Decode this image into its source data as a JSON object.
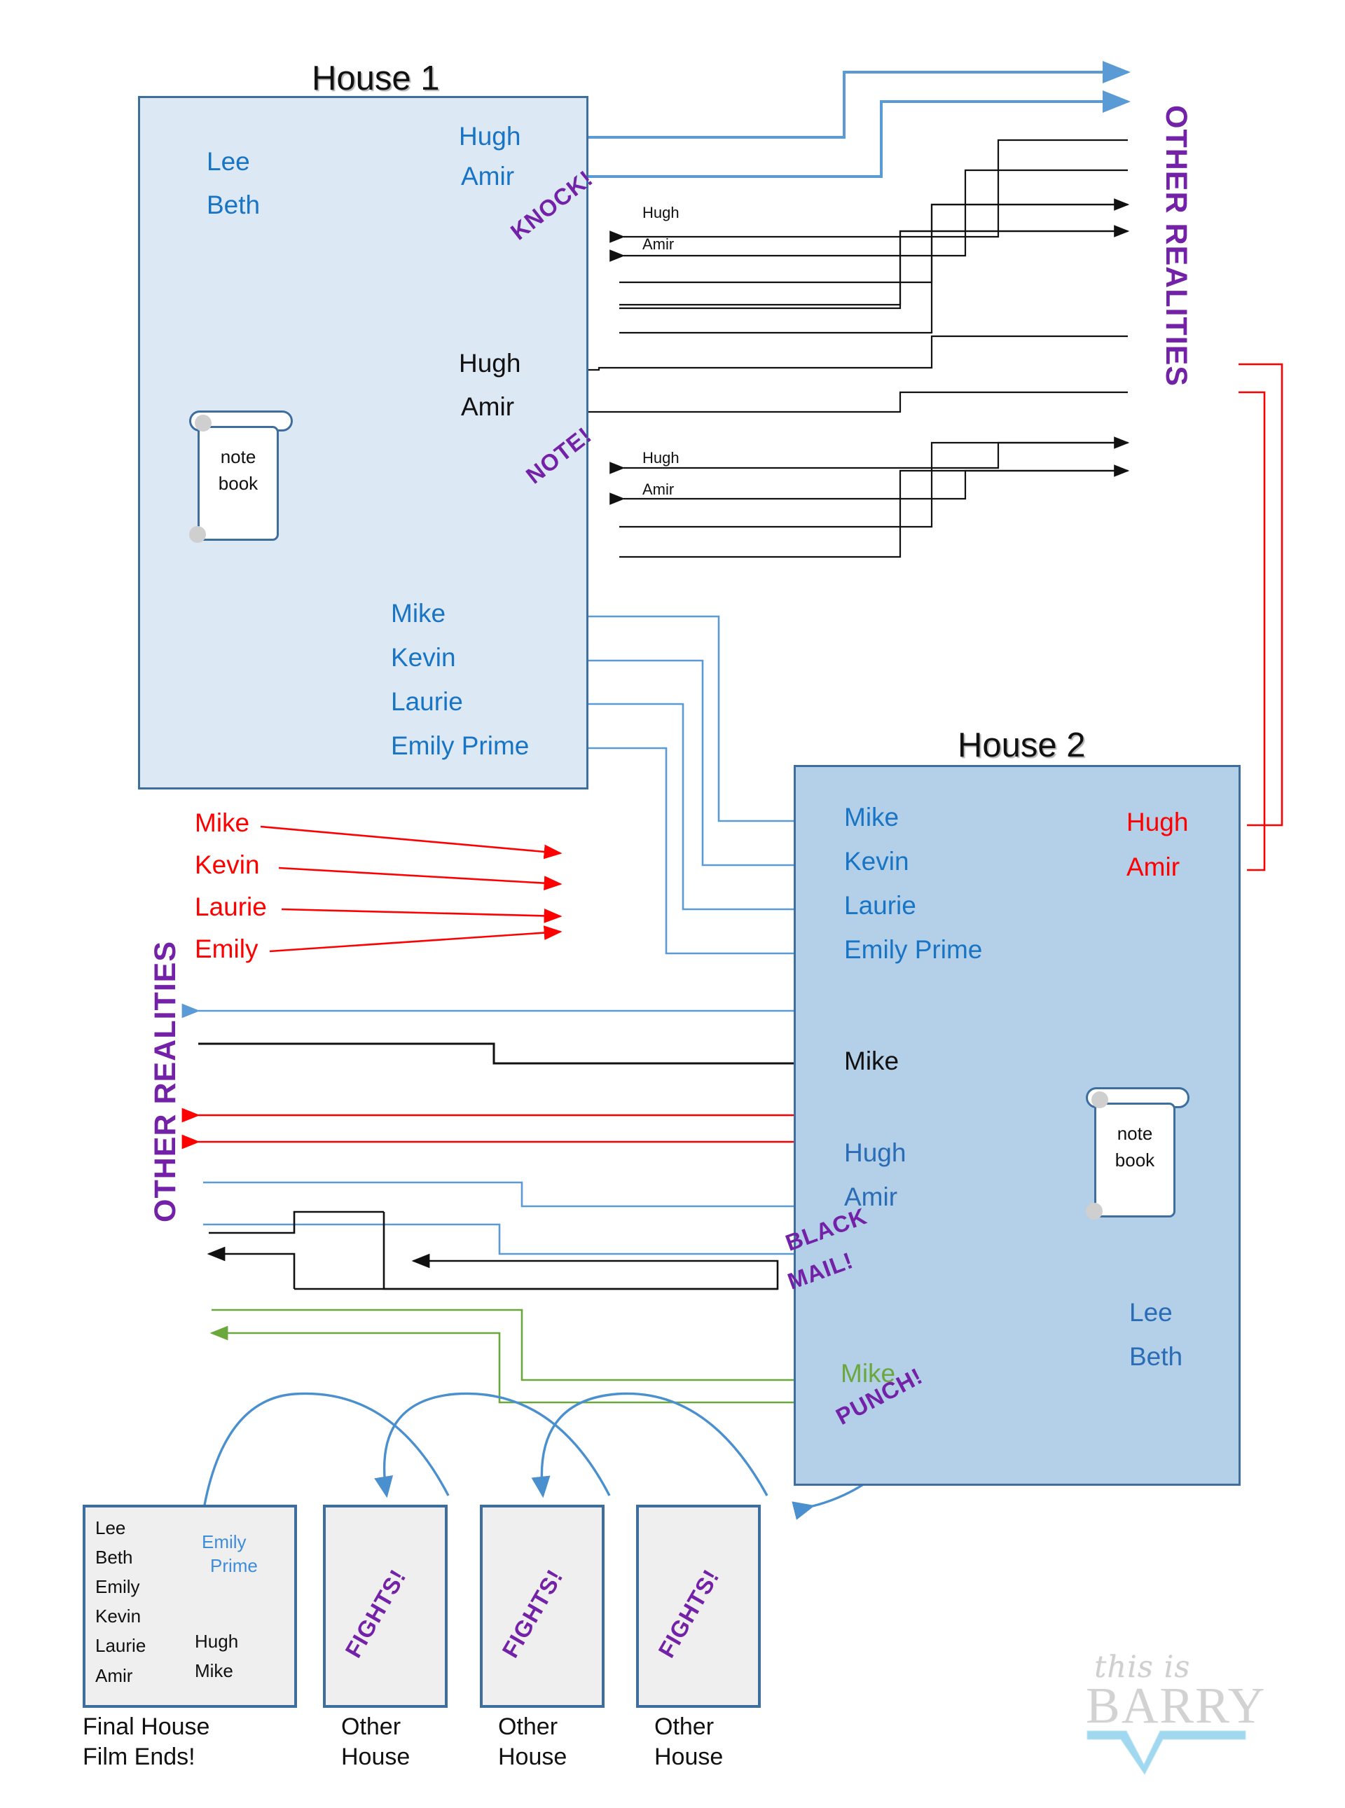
{
  "houses": {
    "house1": {
      "title": "House 1",
      "residents": [
        "Lee",
        "Beth"
      ],
      "notebook": {
        "line1": "note",
        "line2": "book"
      },
      "out_top": [
        "Hugh",
        "Amir"
      ],
      "in_mid": [
        "Hugh",
        "Amir"
      ],
      "out_bottom": [
        "Mike",
        "Kevin",
        "Laurie",
        "Emily Prime"
      ],
      "knock_in_small": [
        "Hugh",
        "Amir"
      ],
      "note_in_small": [
        "Hugh",
        "Amir"
      ]
    },
    "house2": {
      "title": "House 2",
      "residents": [
        "Lee",
        "Beth"
      ],
      "notebook": {
        "line1": "note",
        "line2": "book"
      },
      "in_blue": [
        "Mike",
        "Kevin",
        "Laurie",
        "Emily Prime"
      ],
      "red_names": [
        "Hugh",
        "Amir"
      ],
      "black_name": "Mike",
      "blue_names": [
        "Hugh",
        "Amir"
      ],
      "green_name": "Mike"
    }
  },
  "other_realities": {
    "right_label": "OTHER  REALITIES",
    "left_label": "OTHER  REALITIES",
    "red_senders": [
      "Mike",
      "Kevin",
      "Laurie",
      "Emily"
    ]
  },
  "stamps": {
    "knock": "KNOCK!",
    "note": "NOTE!",
    "blackmail_line1": "BLACK",
    "blackmail_line2": "MAIL!",
    "punch": "PUNCH!",
    "fights": "FIGHTS!"
  },
  "bottom": {
    "final_house": {
      "caption_line1": "Final House",
      "caption_line2": "Film Ends!",
      "col1": [
        "Lee",
        "Beth",
        "Emily",
        "Kevin",
        "Laurie",
        "Amir"
      ],
      "col2": [
        "Hugh",
        "Mike"
      ],
      "emily_prime_line1": "Emily",
      "emily_prime_line2": "Prime"
    },
    "other_houses": [
      {
        "caption_line1": "Other",
        "caption_line2": "House",
        "stamp": "FIGHTS!"
      },
      {
        "caption_line1": "Other",
        "caption_line2": "House",
        "stamp": "FIGHTS!"
      },
      {
        "caption_line1": "Other",
        "caption_line2": "House",
        "stamp": "FIGHTS!"
      }
    ]
  },
  "logo": {
    "line1": "this is",
    "line2": "BARRY"
  },
  "colors": {
    "house1_fill": "#dde8f5",
    "house2_fill": "#b4d0e9",
    "house_border": "#3d6e9e",
    "name_blue": "#1874c4",
    "arrow_blue": "#5b9bd5",
    "red": "#ff0000",
    "green": "#6aa83b",
    "purple": "#7322a8",
    "black": "#111111"
  }
}
